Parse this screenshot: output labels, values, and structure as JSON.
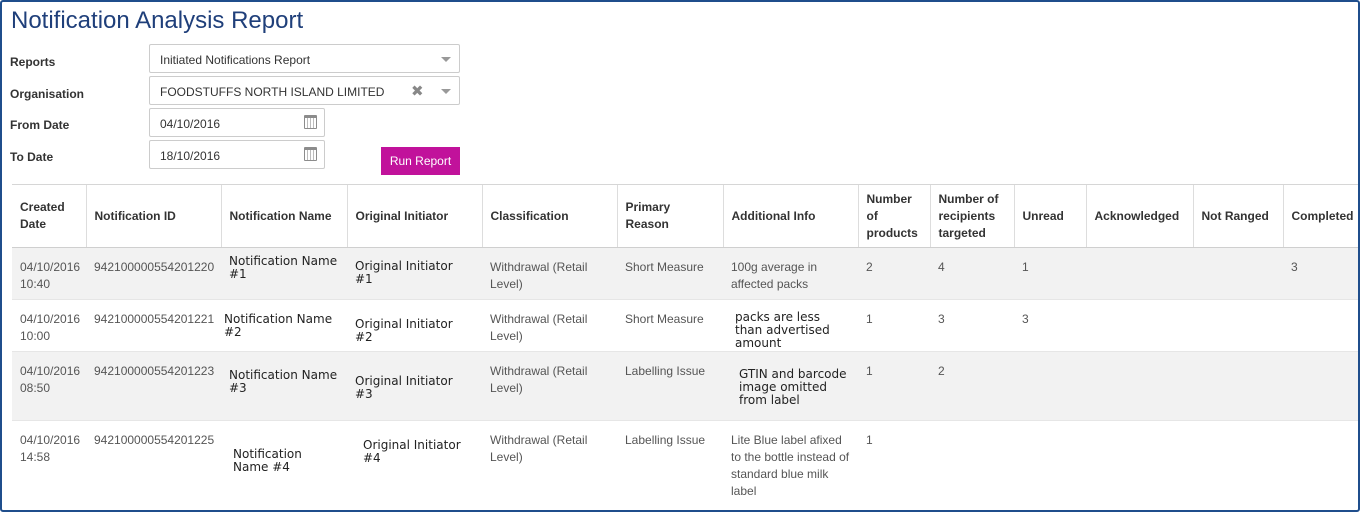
{
  "page": {
    "title": "Notification Analysis Report"
  },
  "form": {
    "reports": {
      "label": "Reports",
      "value": "Initiated Notifications Report"
    },
    "organisation": {
      "label": "Organisation",
      "value": "FOODSTUFFS NORTH ISLAND LIMITED"
    },
    "from_date": {
      "label": "From Date",
      "value": "04/10/2016"
    },
    "to_date": {
      "label": "To Date",
      "value": "18/10/2016"
    },
    "run_button": "Run Report"
  },
  "table": {
    "columns": [
      "Created Date",
      "Notification ID",
      "Notification Name",
      "Original Initiator",
      "Classification",
      "Primary Reason",
      "Additional Info",
      "Number of products",
      "Number of recipients targeted",
      "Unread",
      "Acknowledged",
      "Not Ranged",
      "Completed"
    ],
    "rows": [
      {
        "created_date": "04/10/2016 10:40",
        "notification_id": "942100000554201220",
        "notification_name": "Notification Name #1",
        "original_initiator": "Original Initiator #1",
        "classification": "Withdrawal (Retail Level)",
        "primary_reason": "Short Measure",
        "additional_info": "100g average in affected packs",
        "num_products": "2",
        "num_recipients": "4",
        "unread": "1",
        "acknowledged": "",
        "not_ranged": "",
        "completed": "3"
      },
      {
        "created_date": "04/10/2016 10:00",
        "notification_id": "942100000554201221",
        "notification_name": "Notification Name #2",
        "original_initiator": "Original Initiator #2",
        "classification": "Withdrawal (Retail Level)",
        "primary_reason": "Short Measure",
        "additional_info": "packs are less than advertised amount",
        "num_products": "1",
        "num_recipients": "3",
        "unread": "3",
        "acknowledged": "",
        "not_ranged": "",
        "completed": ""
      },
      {
        "created_date": "04/10/2016 08:50",
        "notification_id": "942100000554201223",
        "notification_name": "Notification Name #3",
        "original_initiator": "Original Initiator #3",
        "classification": "Withdrawal (Retail Level)",
        "primary_reason": "Labelling Issue",
        "additional_info": "GTIN and barcode image omitted from label",
        "num_products": "1",
        "num_recipients": "2",
        "unread": "",
        "acknowledged": "",
        "not_ranged": "",
        "completed": ""
      },
      {
        "created_date": "04/10/2016 14:58",
        "notification_id": "942100000554201225",
        "notification_name": "Notification Name #4",
        "original_initiator": "Original Initiator #4",
        "classification": "Withdrawal (Retail Level)",
        "primary_reason": "Labelling Issue",
        "additional_info": "Lite Blue label afixed to the bottle instead of standard blue milk label",
        "num_products": "1",
        "num_recipients": "",
        "unread": "",
        "acknowledged": "",
        "not_ranged": "",
        "completed": ""
      }
    ]
  },
  "colors": {
    "title": "#1f3f7a",
    "border": "#1f4e8c",
    "button": "#c1129b",
    "alt_row": "#f2f2f2"
  },
  "icons": {
    "dropdown": "chevron-down-icon",
    "clear": "close-icon",
    "date": "calendar-icon"
  }
}
